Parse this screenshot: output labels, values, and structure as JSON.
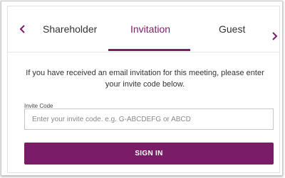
{
  "tabs": {
    "items": [
      {
        "label": "Shareholder"
      },
      {
        "label": "Invitation"
      },
      {
        "label": "Guest"
      }
    ],
    "active": "Invitation"
  },
  "icons": {
    "prev": "chevron-left-icon",
    "next": "chevron-right-icon"
  },
  "invitation": {
    "message": "If you have received an email invitation for this meeting, please enter your invite code below.",
    "field_label": "Invite Code",
    "placeholder": "Enter your invite code. e.g. G-ABCDEFG or ABCD",
    "value": "",
    "button_label": "SIGN IN"
  },
  "colors": {
    "accent": "#7a1c67",
    "text": "#333333",
    "border": "#c6c6c6"
  }
}
